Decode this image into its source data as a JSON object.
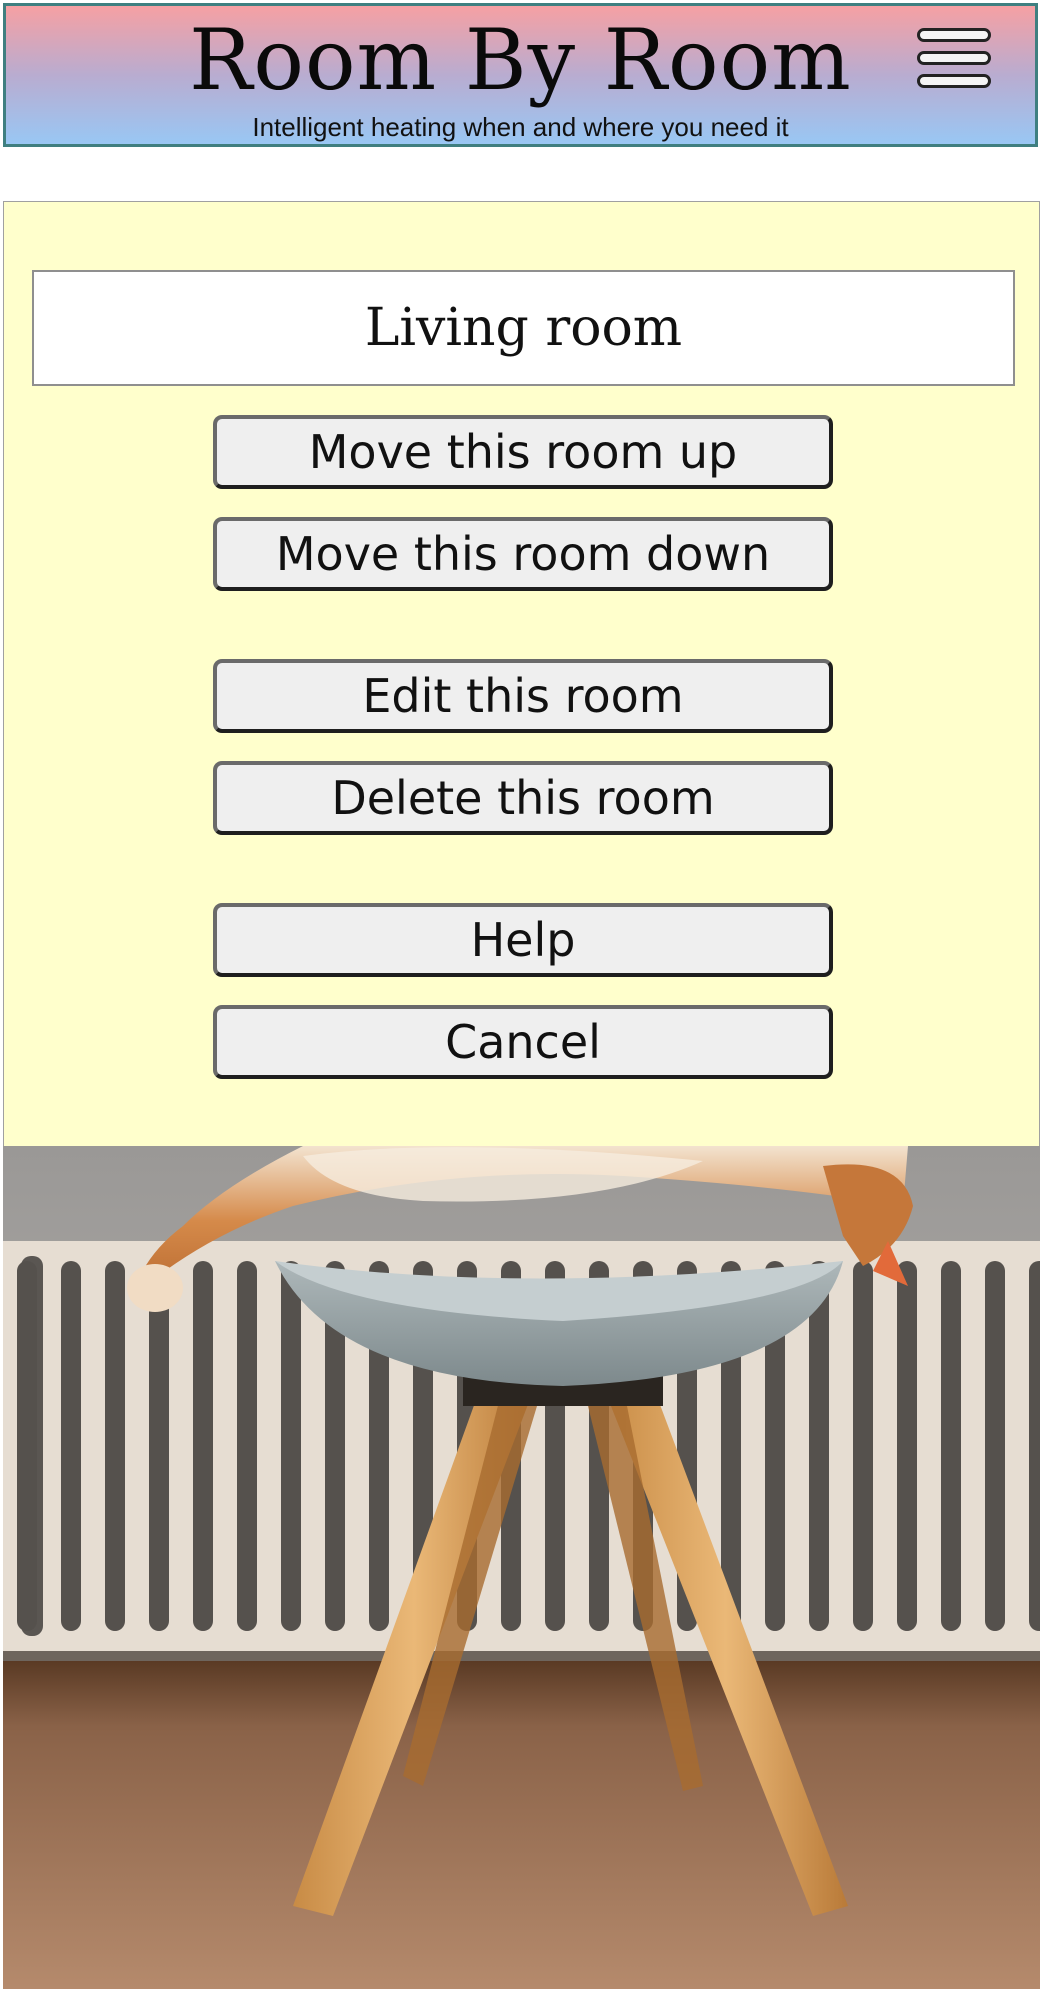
{
  "header": {
    "title": "Room By Room",
    "tagline": "Intelligent heating when and where you need it",
    "menu_icon": "hamburger-menu-icon"
  },
  "room": {
    "name": "Living room"
  },
  "actions": {
    "move_up": "Move this room up",
    "move_down": "Move this room down",
    "edit": "Edit this room",
    "delete": "Delete this room",
    "help": "Help",
    "cancel": "Cancel"
  },
  "colors": {
    "header_gradient_top": "#f6a0a3",
    "header_gradient_bottom": "#99c7f4",
    "header_border": "#3f7f80",
    "panel_background": "#ffffcc",
    "button_background": "#efefef"
  }
}
